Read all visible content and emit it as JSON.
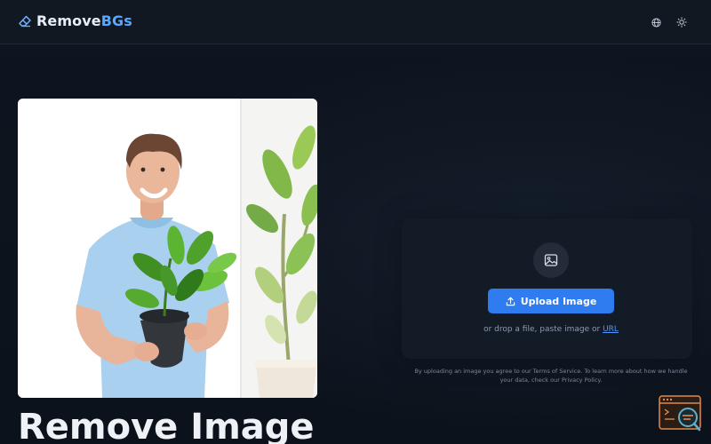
{
  "app": {
    "brand_main": "Remove",
    "brand_accent": "BGs"
  },
  "header": {
    "language_icon": "globe-icon",
    "theme_icon": "sun-icon"
  },
  "hero": {
    "title": "Remove Image",
    "image": "man-holding-potted-plant-photo"
  },
  "upload": {
    "icon": "image-icon",
    "button_label": "Upload Image",
    "hint_prefix": "or drop a file, paste image or",
    "hint_link": "URL",
    "legal_text": "By uploading an image you agree to our Terms of Service. To learn more about how we handle your data, check our Privacy Policy."
  },
  "colors": {
    "accent": "#5aa7ff",
    "button": "#2f7cf1",
    "background": "#0d131d"
  }
}
